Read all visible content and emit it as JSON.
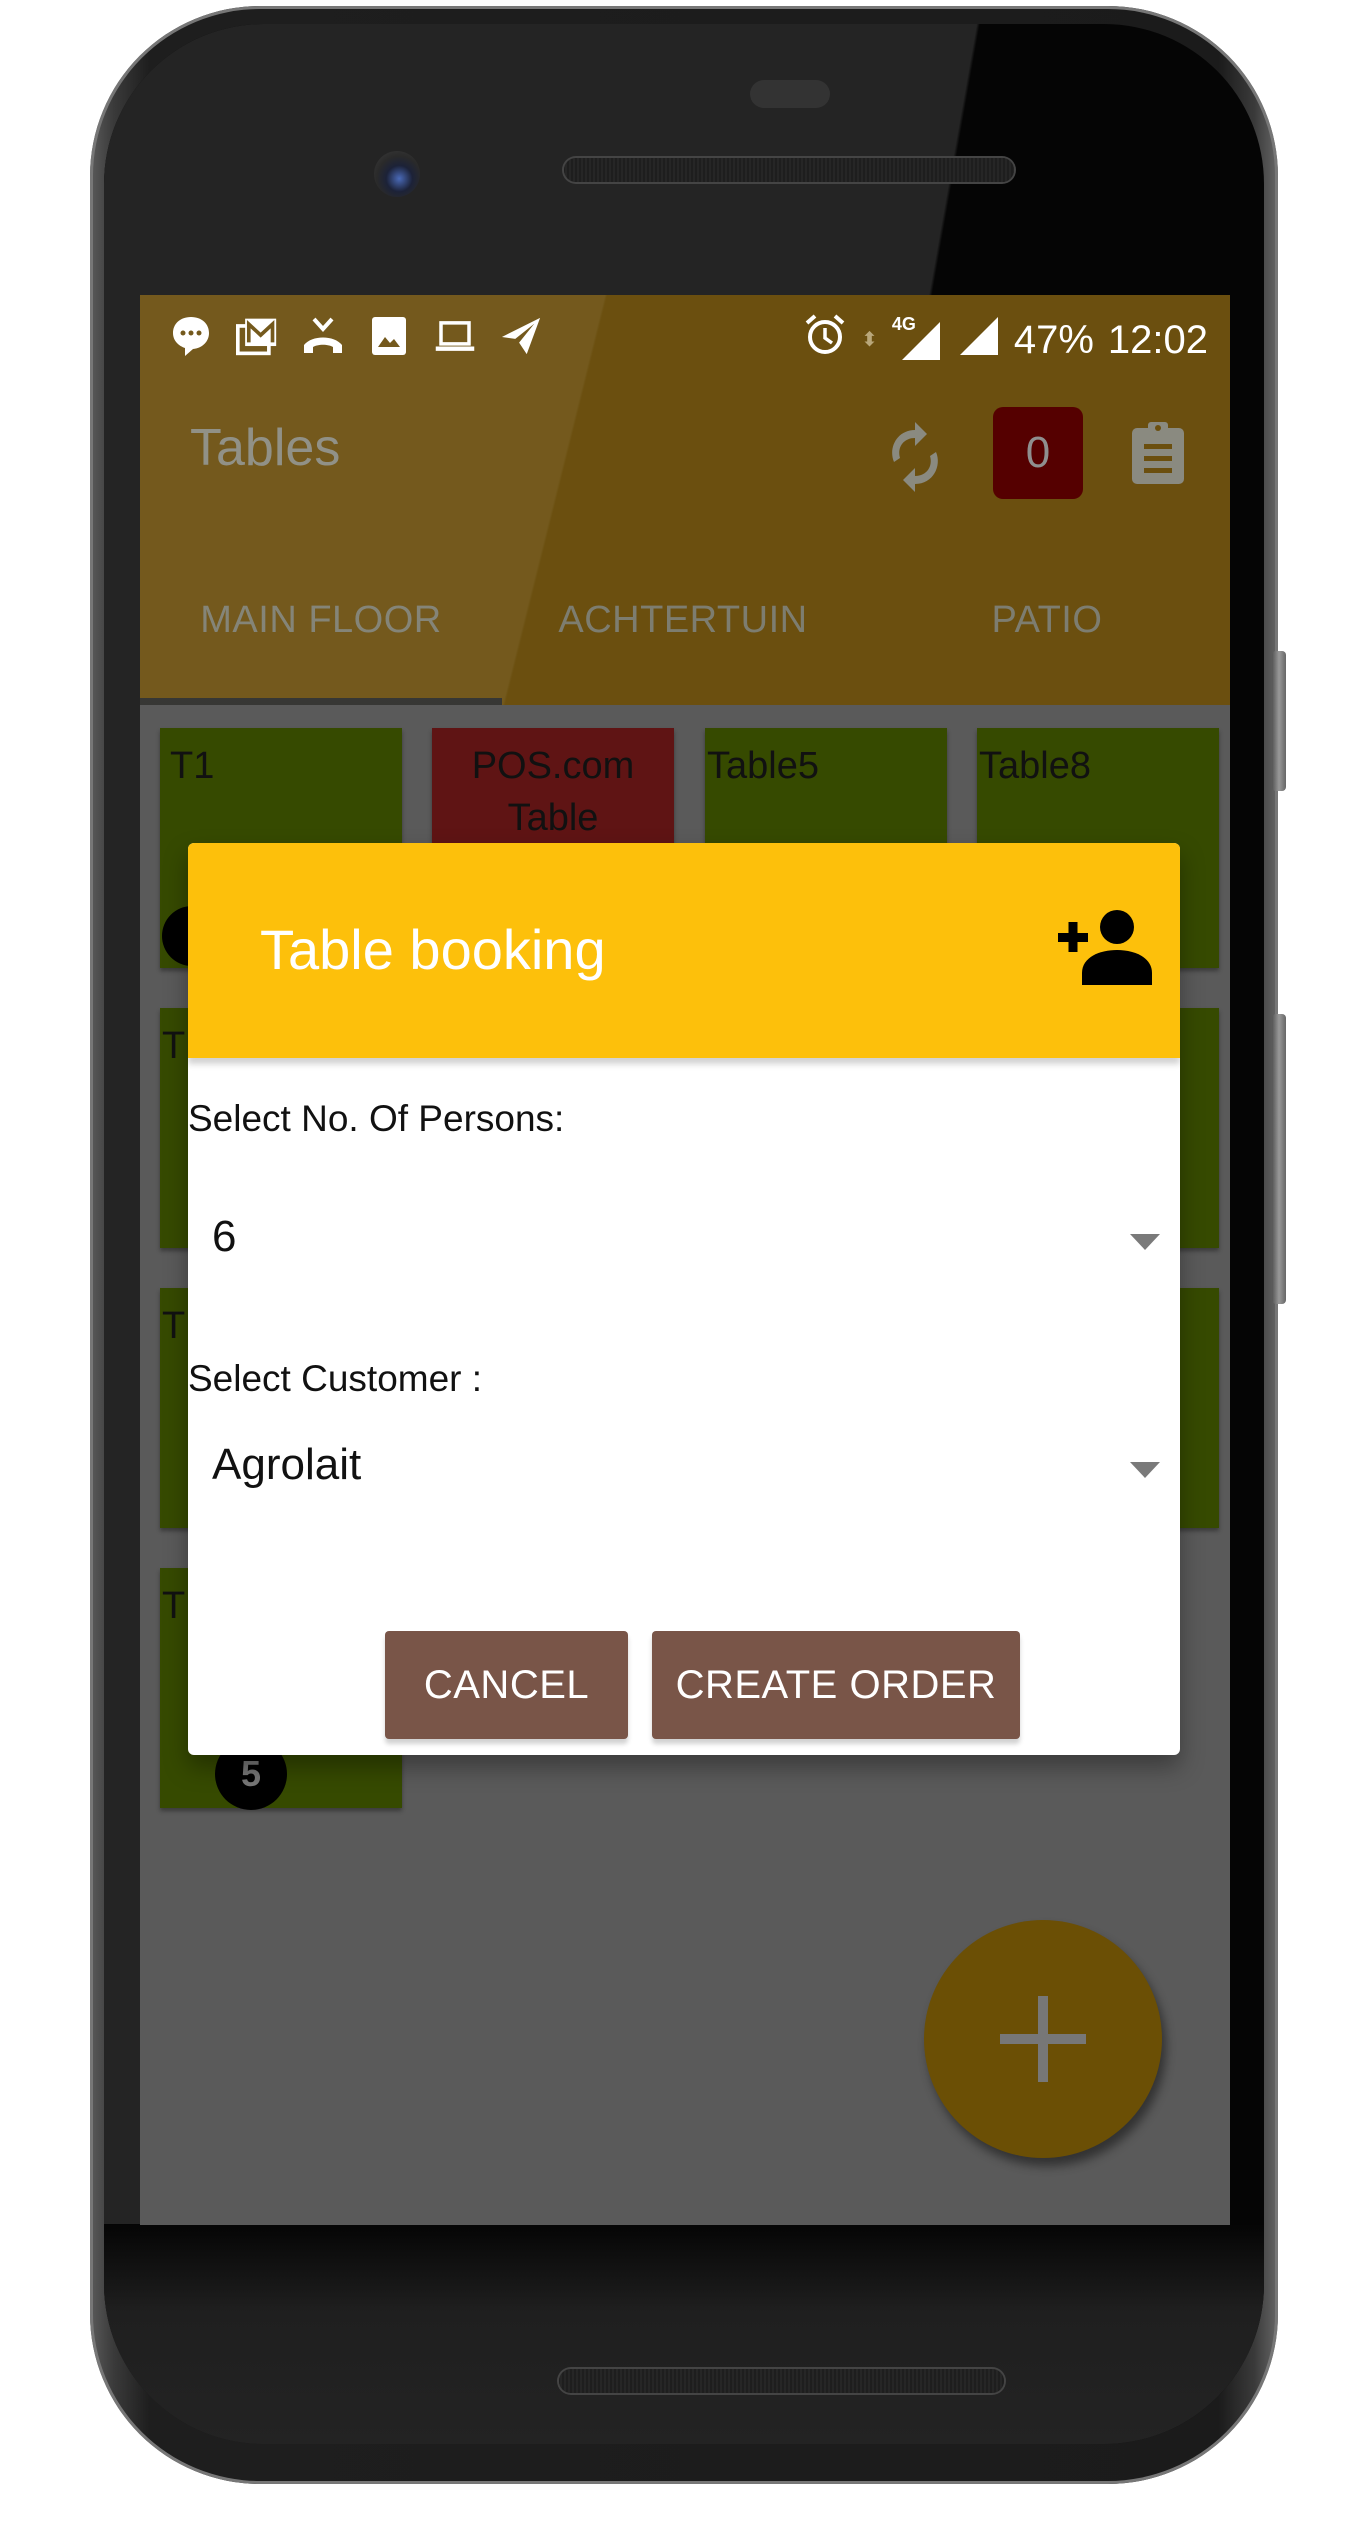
{
  "statusbar": {
    "left_icons": [
      "message-icon",
      "gmail-icon",
      "missed-call-icon",
      "image-icon",
      "laptop-icon",
      "telegram-icon"
    ],
    "network": "4G",
    "battery": "47%",
    "time": "12:02"
  },
  "appbar": {
    "title": "Tables",
    "order_count": "0"
  },
  "tabs": [
    {
      "label": "MAIN FLOOR",
      "active": true
    },
    {
      "label": "ACHTERTUIN",
      "active": false
    },
    {
      "label": "PATIO",
      "active": false
    }
  ],
  "tables": [
    {
      "name": "T1",
      "status": "free",
      "guests": ""
    },
    {
      "name": "POS.com Table",
      "status": "occupied"
    },
    {
      "name": "Table5",
      "status": "free"
    },
    {
      "name": "Table8",
      "status": "free"
    },
    {
      "name": "T",
      "status": "free"
    },
    {
      "name": "T",
      "status": "free"
    },
    {
      "name": "T",
      "status": "free",
      "guests": "5"
    }
  ],
  "dialog": {
    "title": "Table booking",
    "persons_label": "Select No. Of Persons:",
    "persons_value": "6",
    "customer_label": "Select Customer :",
    "customer_value": "Agrolait",
    "cancel_label": "CANCEL",
    "create_label": "CREATE ORDER"
  },
  "colors": {
    "dialog_header": "#fdc00b",
    "button": "#795548",
    "table_free": "#364a00",
    "table_occupied": "#5f1414",
    "appbar_dimmed": "#6b4f0f",
    "badge": "#550000"
  }
}
